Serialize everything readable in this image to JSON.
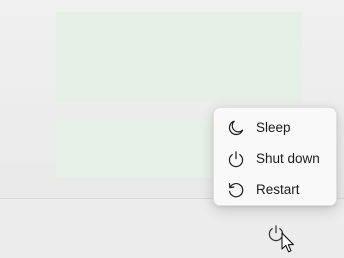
{
  "power_menu": {
    "items": [
      {
        "label": "Sleep",
        "icon": "moon-icon"
      },
      {
        "label": "Shut down",
        "icon": "power-icon"
      },
      {
        "label": "Restart",
        "icon": "restart-icon"
      }
    ]
  },
  "taskbar": {
    "power_button_icon": "power-icon"
  },
  "colors": {
    "menu_background": "#f9f9f9",
    "text": "#1b1b1b",
    "icon_stroke": "#1b1b1b"
  }
}
